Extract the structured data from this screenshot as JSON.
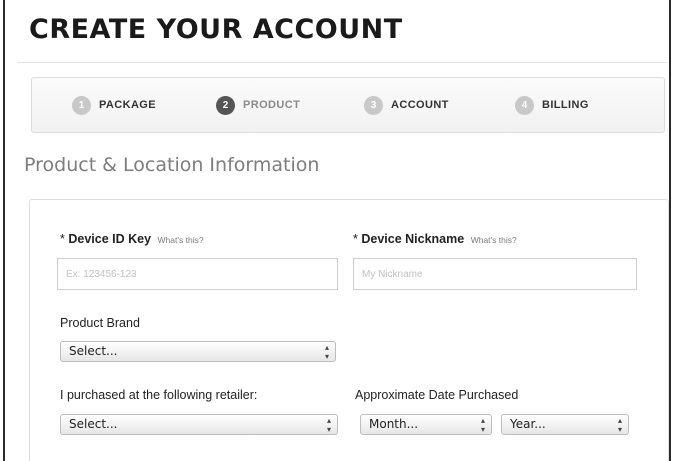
{
  "page_title": "CREATE YOUR ACCOUNT",
  "steps": [
    {
      "number": "1",
      "label": "PACKAGE",
      "state": "inactive"
    },
    {
      "number": "2",
      "label": "PRODUCT",
      "state": "active"
    },
    {
      "number": "3",
      "label": "ACCOUNT",
      "state": "inactive"
    },
    {
      "number": "4",
      "label": "BILLING",
      "state": "inactive"
    }
  ],
  "section_title": "Product & Location Information",
  "form": {
    "device_id": {
      "required": "*",
      "label": "Device ID Key",
      "help": "What's this?",
      "placeholder": "Ex: 123456-123",
      "value": ""
    },
    "device_nickname": {
      "required": "*",
      "label": "Device Nickname",
      "help": "What's this?",
      "placeholder": "My Nickname",
      "value": ""
    },
    "product_brand": {
      "label": "Product Brand",
      "selected": "Select..."
    },
    "retailer": {
      "label": "I purchased at the following retailer:",
      "selected": "Select..."
    },
    "date_purchased": {
      "label": "Approximate Date Purchased",
      "month_selected": "Month...",
      "year_selected": "Year..."
    }
  },
  "colors": {
    "active_step": "#555555",
    "inactive_step": "#c8c8c8",
    "section_title": "#7d7d7d"
  },
  "icons": {
    "select_arrows": "up-down-chevron-icon"
  }
}
